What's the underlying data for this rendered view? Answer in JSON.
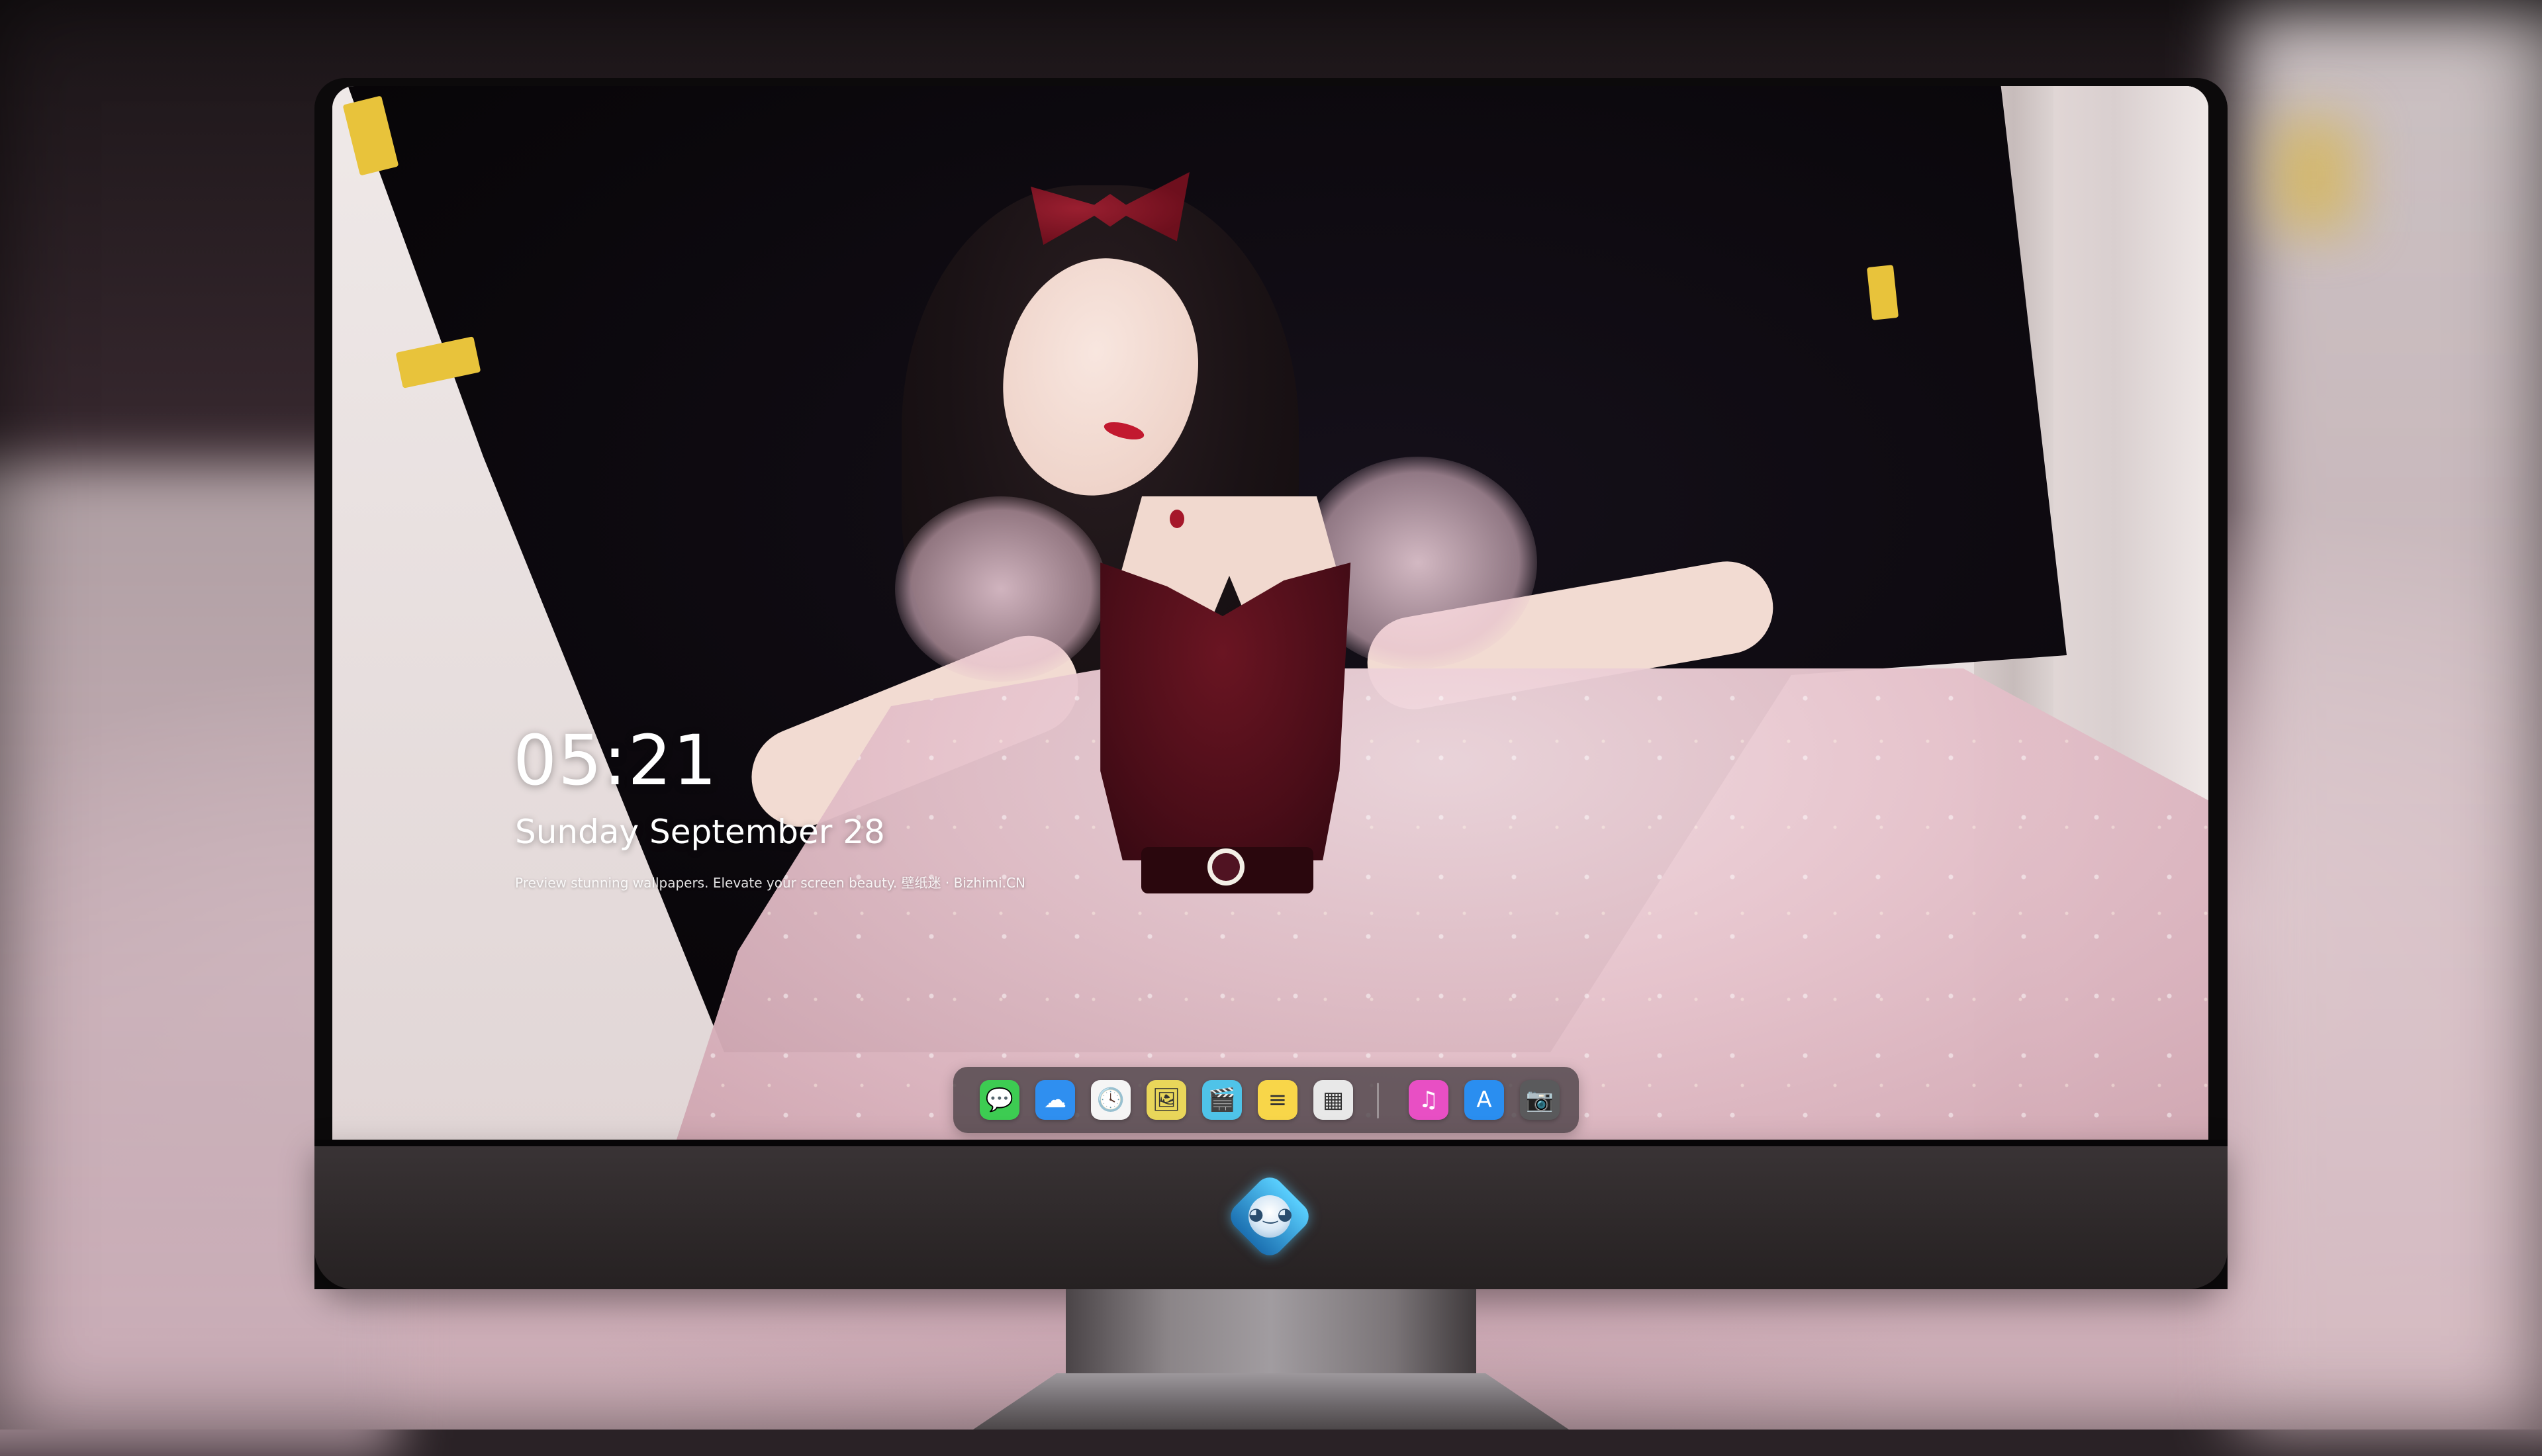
{
  "lock_screen": {
    "time": "05:21",
    "date": "Sunday September  28",
    "caption": "Preview stunning wallpapers. Elevate your screen beauty. 壁纸迷 · Bizhimi.CN"
  },
  "dock": {
    "apps": [
      {
        "name": "messages-icon",
        "glyph": "💬",
        "color": "#3dcc52"
      },
      {
        "name": "weather-icon",
        "glyph": "☁",
        "color": "#2f8ff0"
      },
      {
        "name": "clock-icon",
        "glyph": "🕓",
        "color": "#f5f5f5"
      },
      {
        "name": "preview-icon",
        "glyph": "🖼",
        "color": "#e9d65a"
      },
      {
        "name": "clips-icon",
        "glyph": "🎬",
        "color": "#4fc3e8"
      },
      {
        "name": "notes-icon",
        "glyph": "≡",
        "color": "#f8d649"
      },
      {
        "name": "photo-booth-icon",
        "glyph": "▦",
        "color": "#e8e8e8"
      },
      {
        "name": "music-icon",
        "glyph": "♫",
        "color": "#e84fc4"
      },
      {
        "name": "app-store-icon",
        "glyph": "A",
        "color": "#2a8ef0"
      },
      {
        "name": "camera-icon",
        "glyph": "📷",
        "color": "#5a5a5c"
      }
    ]
  },
  "colors": {
    "dock_background": "#463e42",
    "monitor_chin": "#2d2829",
    "clock_text": "#ffffff"
  }
}
